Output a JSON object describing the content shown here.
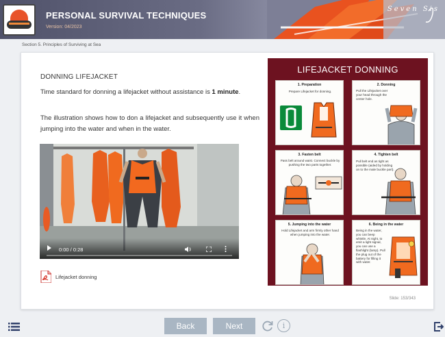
{
  "header": {
    "title": "PERSONAL SURVIVAL TECHNIQUES",
    "version": "Version: 04/2023",
    "brand": "Seven Sis"
  },
  "breadcrumb": "Section 5. Principles of Surviving at Sea",
  "lesson": {
    "title": "DONNING LIFEJACKET",
    "p1_text": "Time standard for donning a lifejacket without assistance is ",
    "p1_strong": "1 minute",
    "p1_end": ".",
    "p2": "The illustration shows how to don a lifejacket and subsequently use it when jumping into the water and when in the water."
  },
  "video": {
    "time": "0:00 / 0:28",
    "progress_fraction": 0
  },
  "attachment": {
    "label": "Lifejacket donning",
    "icon": "pdf-icon"
  },
  "poster": {
    "title": "LIFEJACKET DONNING",
    "steps": [
      {
        "title": "1. Preparation",
        "text": "Prepare Lifejacket for donning."
      },
      {
        "title": "2. Donning",
        "text": "Pull the Lifejacket over your head through the center hole."
      },
      {
        "title": "3. Fasten belt",
        "text": "Pass belt around waist. Connect buckle by pushing the two parts together."
      },
      {
        "title": "4. Tighten belt",
        "text": "Pull belt end as tight as possible (aided by holding on to the male buckle part)."
      },
      {
        "title": "5. Jumping into the water",
        "text": "Hold Lifejacket and arm firmly other hand when jumping into the water."
      },
      {
        "title": "6. Being in the water",
        "text": "Being in the water, you can beep whistle. At night, to emit a light signal, you can use a flashlight (lamp). Pull the plug out of the battery for filling it with water."
      }
    ]
  },
  "slide": "Slide: 153/343",
  "nav": {
    "back": "Back",
    "next": "Next"
  },
  "colors": {
    "poster_bg": "#6d1220",
    "vest_orange": "#f06a1f",
    "nav_button": "#a9b6c3"
  }
}
